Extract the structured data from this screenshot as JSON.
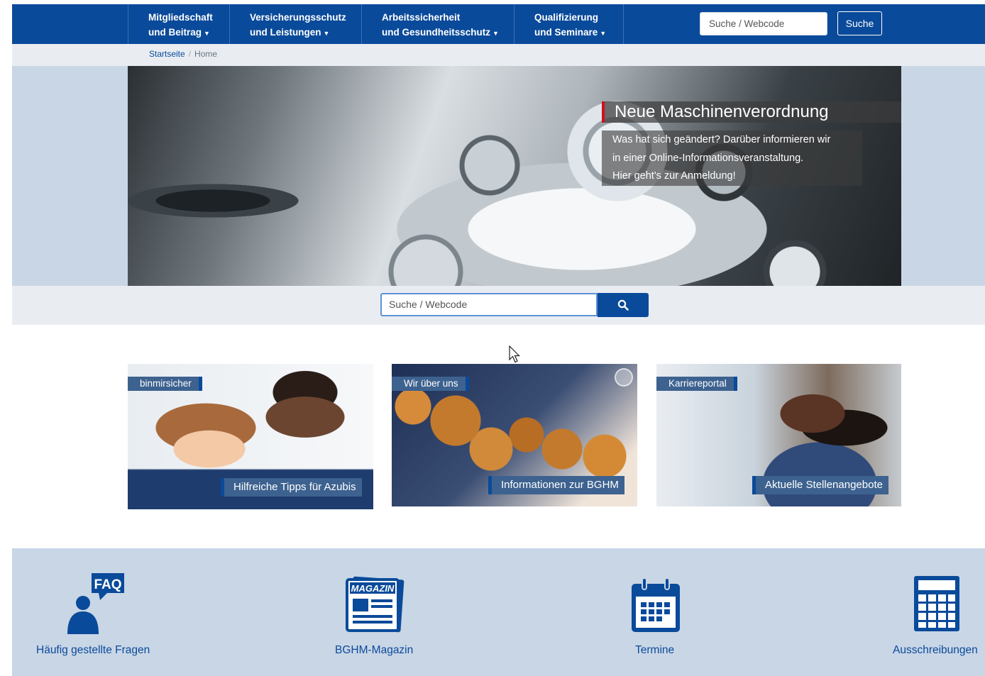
{
  "nav": {
    "items": [
      {
        "line1": "Mitgliedschaft",
        "line2": "und Beitrag"
      },
      {
        "line1": "Versicherungsschutz",
        "line2": "und Leistungen"
      },
      {
        "line1": "Arbeitssicherheit",
        "line2": "und Gesundheitsschutz"
      },
      {
        "line1": "Qualifizierung",
        "line2": "und Seminare"
      }
    ],
    "search_placeholder": "Suche / Webcode",
    "search_button": "Suche"
  },
  "breadcrumb": {
    "home": "Startseite",
    "separator": "/",
    "current": "Home"
  },
  "hero": {
    "title": "Neue Maschinenverordnung",
    "lines": [
      "Was hat sich geändert? Darüber informieren wir",
      "in einer Online-Informationsveranstaltung.",
      "Hier geht's zur Anmeldung!"
    ]
  },
  "main_search": {
    "placeholder": "Suche / Webcode"
  },
  "cards": [
    {
      "tag": "binmirsicher",
      "caption": "Hilfreiche Tipps für Azubis"
    },
    {
      "tag": "Wir über uns",
      "caption": "Informationen zur BGHM"
    },
    {
      "tag": "Karriereportal",
      "caption": "Aktuelle Stellenangebote"
    }
  ],
  "quick_links": [
    {
      "label": "Häufig gestellte Fragen",
      "icon": "faq-icon",
      "badge": "FAQ"
    },
    {
      "label": "BGHM-Magazin",
      "icon": "magazine-icon",
      "badge": "MAGAZIN"
    },
    {
      "label": "Termine",
      "icon": "calendar-icon"
    },
    {
      "label": "Ausschreibungen",
      "icon": "calculator-icon"
    }
  ],
  "colors": {
    "primary": "#0a4a9a",
    "band": "#c9d6e6",
    "light": "#e9edf2",
    "accent_red": "#d0101d"
  }
}
